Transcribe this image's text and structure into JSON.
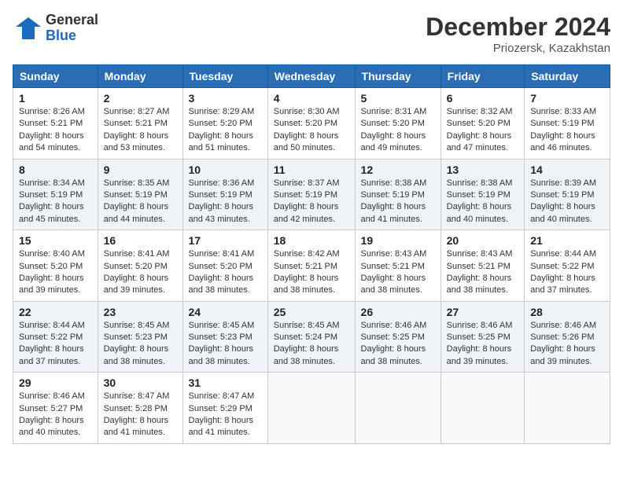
{
  "logo": {
    "general": "General",
    "blue": "Blue"
  },
  "header": {
    "month": "December 2024",
    "location": "Priozersk, Kazakhstan"
  },
  "weekdays": [
    "Sunday",
    "Monday",
    "Tuesday",
    "Wednesday",
    "Thursday",
    "Friday",
    "Saturday"
  ],
  "weeks": [
    [
      {
        "day": "1",
        "sunrise": "8:26 AM",
        "sunset": "5:21 PM",
        "daylight": "8 hours and 54 minutes."
      },
      {
        "day": "2",
        "sunrise": "8:27 AM",
        "sunset": "5:21 PM",
        "daylight": "8 hours and 53 minutes."
      },
      {
        "day": "3",
        "sunrise": "8:29 AM",
        "sunset": "5:20 PM",
        "daylight": "8 hours and 51 minutes."
      },
      {
        "day": "4",
        "sunrise": "8:30 AM",
        "sunset": "5:20 PM",
        "daylight": "8 hours and 50 minutes."
      },
      {
        "day": "5",
        "sunrise": "8:31 AM",
        "sunset": "5:20 PM",
        "daylight": "8 hours and 49 minutes."
      },
      {
        "day": "6",
        "sunrise": "8:32 AM",
        "sunset": "5:20 PM",
        "daylight": "8 hours and 47 minutes."
      },
      {
        "day": "7",
        "sunrise": "8:33 AM",
        "sunset": "5:19 PM",
        "daylight": "8 hours and 46 minutes."
      }
    ],
    [
      {
        "day": "8",
        "sunrise": "8:34 AM",
        "sunset": "5:19 PM",
        "daylight": "8 hours and 45 minutes."
      },
      {
        "day": "9",
        "sunrise": "8:35 AM",
        "sunset": "5:19 PM",
        "daylight": "8 hours and 44 minutes."
      },
      {
        "day": "10",
        "sunrise": "8:36 AM",
        "sunset": "5:19 PM",
        "daylight": "8 hours and 43 minutes."
      },
      {
        "day": "11",
        "sunrise": "8:37 AM",
        "sunset": "5:19 PM",
        "daylight": "8 hours and 42 minutes."
      },
      {
        "day": "12",
        "sunrise": "8:38 AM",
        "sunset": "5:19 PM",
        "daylight": "8 hours and 41 minutes."
      },
      {
        "day": "13",
        "sunrise": "8:38 AM",
        "sunset": "5:19 PM",
        "daylight": "8 hours and 40 minutes."
      },
      {
        "day": "14",
        "sunrise": "8:39 AM",
        "sunset": "5:19 PM",
        "daylight": "8 hours and 40 minutes."
      }
    ],
    [
      {
        "day": "15",
        "sunrise": "8:40 AM",
        "sunset": "5:20 PM",
        "daylight": "8 hours and 39 minutes."
      },
      {
        "day": "16",
        "sunrise": "8:41 AM",
        "sunset": "5:20 PM",
        "daylight": "8 hours and 39 minutes."
      },
      {
        "day": "17",
        "sunrise": "8:41 AM",
        "sunset": "5:20 PM",
        "daylight": "8 hours and 38 minutes."
      },
      {
        "day": "18",
        "sunrise": "8:42 AM",
        "sunset": "5:21 PM",
        "daylight": "8 hours and 38 minutes."
      },
      {
        "day": "19",
        "sunrise": "8:43 AM",
        "sunset": "5:21 PM",
        "daylight": "8 hours and 38 minutes."
      },
      {
        "day": "20",
        "sunrise": "8:43 AM",
        "sunset": "5:21 PM",
        "daylight": "8 hours and 38 minutes."
      },
      {
        "day": "21",
        "sunrise": "8:44 AM",
        "sunset": "5:22 PM",
        "daylight": "8 hours and 37 minutes."
      }
    ],
    [
      {
        "day": "22",
        "sunrise": "8:44 AM",
        "sunset": "5:22 PM",
        "daylight": "8 hours and 37 minutes."
      },
      {
        "day": "23",
        "sunrise": "8:45 AM",
        "sunset": "5:23 PM",
        "daylight": "8 hours and 38 minutes."
      },
      {
        "day": "24",
        "sunrise": "8:45 AM",
        "sunset": "5:23 PM",
        "daylight": "8 hours and 38 minutes."
      },
      {
        "day": "25",
        "sunrise": "8:45 AM",
        "sunset": "5:24 PM",
        "daylight": "8 hours and 38 minutes."
      },
      {
        "day": "26",
        "sunrise": "8:46 AM",
        "sunset": "5:25 PM",
        "daylight": "8 hours and 38 minutes."
      },
      {
        "day": "27",
        "sunrise": "8:46 AM",
        "sunset": "5:25 PM",
        "daylight": "8 hours and 39 minutes."
      },
      {
        "day": "28",
        "sunrise": "8:46 AM",
        "sunset": "5:26 PM",
        "daylight": "8 hours and 39 minutes."
      }
    ],
    [
      {
        "day": "29",
        "sunrise": "8:46 AM",
        "sunset": "5:27 PM",
        "daylight": "8 hours and 40 minutes."
      },
      {
        "day": "30",
        "sunrise": "8:47 AM",
        "sunset": "5:28 PM",
        "daylight": "8 hours and 41 minutes."
      },
      {
        "day": "31",
        "sunrise": "8:47 AM",
        "sunset": "5:29 PM",
        "daylight": "8 hours and 41 minutes."
      },
      null,
      null,
      null,
      null
    ]
  ]
}
